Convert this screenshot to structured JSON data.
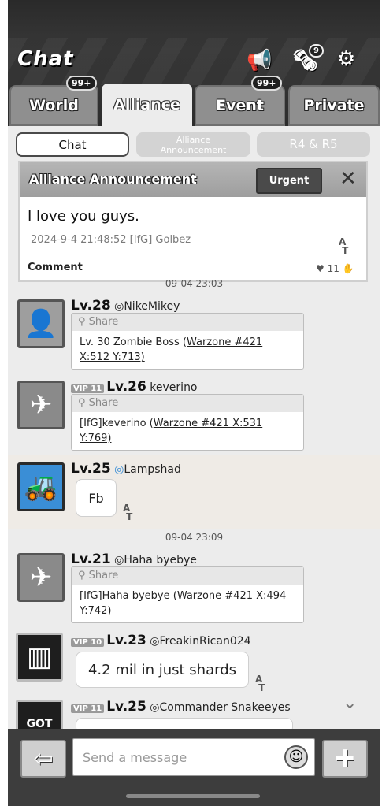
{
  "header": {
    "title": "Chat",
    "mail_badge": "9"
  },
  "tabs": [
    {
      "label": "World",
      "badge": "99+"
    },
    {
      "label": "Alliance",
      "badge": ""
    },
    {
      "label": "Event",
      "badge": "99+"
    },
    {
      "label": "Private",
      "badge": ""
    }
  ],
  "subtabs": {
    "chat": "Chat",
    "announcement": "Alliance Announcement",
    "r4r5": "R4 & R5"
  },
  "announcement": {
    "title": "Alliance Announcement",
    "urgent": "Urgent",
    "message": "I love you guys.",
    "meta": "2024-9-4 21:48:52 [IfG] Golbez",
    "comment": "Comment",
    "likes": "11"
  },
  "messages": {
    "ts1": "09-04 23:03",
    "m1": {
      "level": "Lv.28",
      "name": "NikeMikey",
      "share": "Share",
      "line1": "Lv. 30 Zombie Boss (",
      "link1": "Warzone #421",
      "line2": "X:512  Y:713)"
    },
    "m2": {
      "vip": "VIP 11",
      "level": "Lv.26",
      "name": "keverino",
      "share": "Share",
      "line1": "[IfG]keverino (",
      "link1": "Warzone #421 X:531",
      "line2": "Y:769)"
    },
    "m3": {
      "level": "Lv.25",
      "name": "Lampshad",
      "text": "Fb"
    },
    "ts2": "09-04 23:09",
    "m4": {
      "level": "Lv.21",
      "name": "Haha byebye",
      "share": "Share",
      "line1": "[IfG]Haha byebye (",
      "link1": "Warzone #421 X:494",
      "line2": "Y:742)"
    },
    "m5": {
      "vip": "VIP 10",
      "level": "Lv.23",
      "name": "FreakinRican024",
      "text": "4.2 mil in just shards"
    },
    "m6": {
      "vip": "VIP 11",
      "level": "Lv.25",
      "name": "Commander Snakeeyes"
    }
  },
  "footer": {
    "placeholder": "Send a message"
  }
}
